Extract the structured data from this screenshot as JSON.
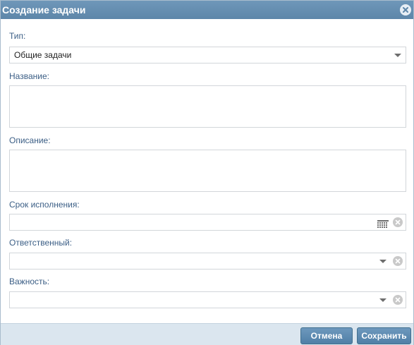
{
  "dialog": {
    "title": "Создание задачи",
    "close_icon": "close-icon"
  },
  "form": {
    "type": {
      "label": "Тип:",
      "value": "Общие задачи",
      "icon": "chevron-down-icon"
    },
    "name": {
      "label": "Название:",
      "value": ""
    },
    "description": {
      "label": "Описание:",
      "value": ""
    },
    "deadline": {
      "label": "Срок исполнения:",
      "value": "",
      "icons": [
        "calendar-icon",
        "clear-icon"
      ]
    },
    "responsible": {
      "label": "Ответственный:",
      "value": "",
      "icons": [
        "chevron-down-icon",
        "clear-icon"
      ]
    },
    "importance": {
      "label": "Важность:",
      "value": "",
      "icons": [
        "chevron-down-icon",
        "clear-icon"
      ]
    }
  },
  "footer": {
    "cancel_label": "Отмена",
    "save_label": "Сохранить"
  },
  "colors": {
    "titlebar": "#5d86a9",
    "label": "#3b5e85",
    "button": "#5a88ae",
    "footer": "#dbe6ef"
  }
}
